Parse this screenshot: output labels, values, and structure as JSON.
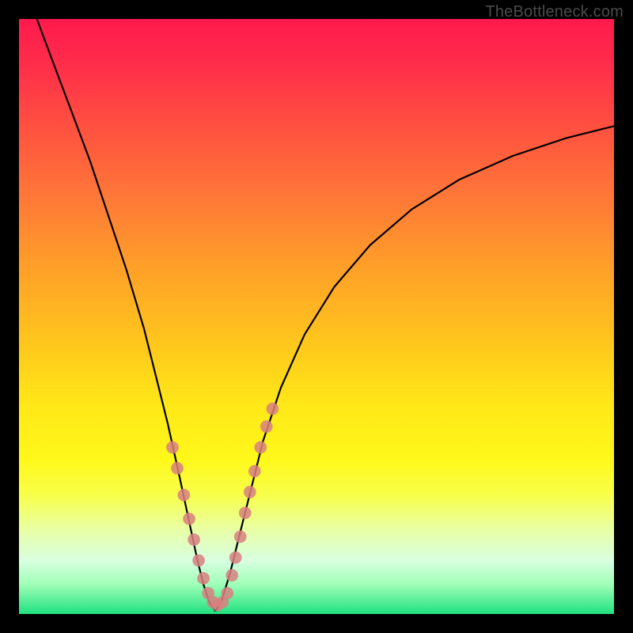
{
  "watermark": "TheBottleneck.com",
  "colors": {
    "background": "#000000",
    "curve": "#000000",
    "marker": "#d88080",
    "gradient_top": "#ff1a4d",
    "gradient_bottom": "#20e080"
  },
  "chart_data": {
    "type": "line",
    "title": "",
    "xlabel": "",
    "ylabel": "",
    "xlim": [
      0,
      100
    ],
    "ylim": [
      0,
      100
    ],
    "x_min": 33,
    "series": [
      {
        "name": "left-branch",
        "x": [
          3,
          6,
          9,
          12,
          15,
          18,
          21,
          23,
          25,
          27,
          28.5,
          30,
          31,
          32,
          33
        ],
        "y": [
          100,
          92,
          84,
          76,
          67,
          58,
          48,
          40,
          32,
          23,
          16,
          9,
          5,
          2,
          0.5
        ]
      },
      {
        "name": "right-branch",
        "x": [
          33,
          34,
          35.5,
          37,
          39,
          41,
          44,
          48,
          53,
          59,
          66,
          74,
          83,
          92,
          100
        ],
        "y": [
          0.5,
          2,
          7,
          13,
          21,
          29,
          38,
          47,
          55,
          62,
          68,
          73,
          77,
          80,
          82
        ]
      }
    ],
    "markers": {
      "name": "sample-points",
      "points": [
        {
          "x": 25.8,
          "y": 28
        },
        {
          "x": 26.6,
          "y": 24.5
        },
        {
          "x": 27.7,
          "y": 20
        },
        {
          "x": 28.6,
          "y": 16
        },
        {
          "x": 29.4,
          "y": 12.5
        },
        {
          "x": 30.2,
          "y": 9
        },
        {
          "x": 31.0,
          "y": 6
        },
        {
          "x": 31.8,
          "y": 3.5
        },
        {
          "x": 32.6,
          "y": 2
        },
        {
          "x": 33.4,
          "y": 1.5
        },
        {
          "x": 34.2,
          "y": 2
        },
        {
          "x": 35.0,
          "y": 3.5
        },
        {
          "x": 35.8,
          "y": 6.5
        },
        {
          "x": 36.4,
          "y": 9.5
        },
        {
          "x": 37.2,
          "y": 13
        },
        {
          "x": 38.0,
          "y": 17
        },
        {
          "x": 38.8,
          "y": 20.5
        },
        {
          "x": 39.6,
          "y": 24
        },
        {
          "x": 40.6,
          "y": 28
        },
        {
          "x": 41.6,
          "y": 31.5
        },
        {
          "x": 42.6,
          "y": 34.5
        }
      ]
    }
  }
}
